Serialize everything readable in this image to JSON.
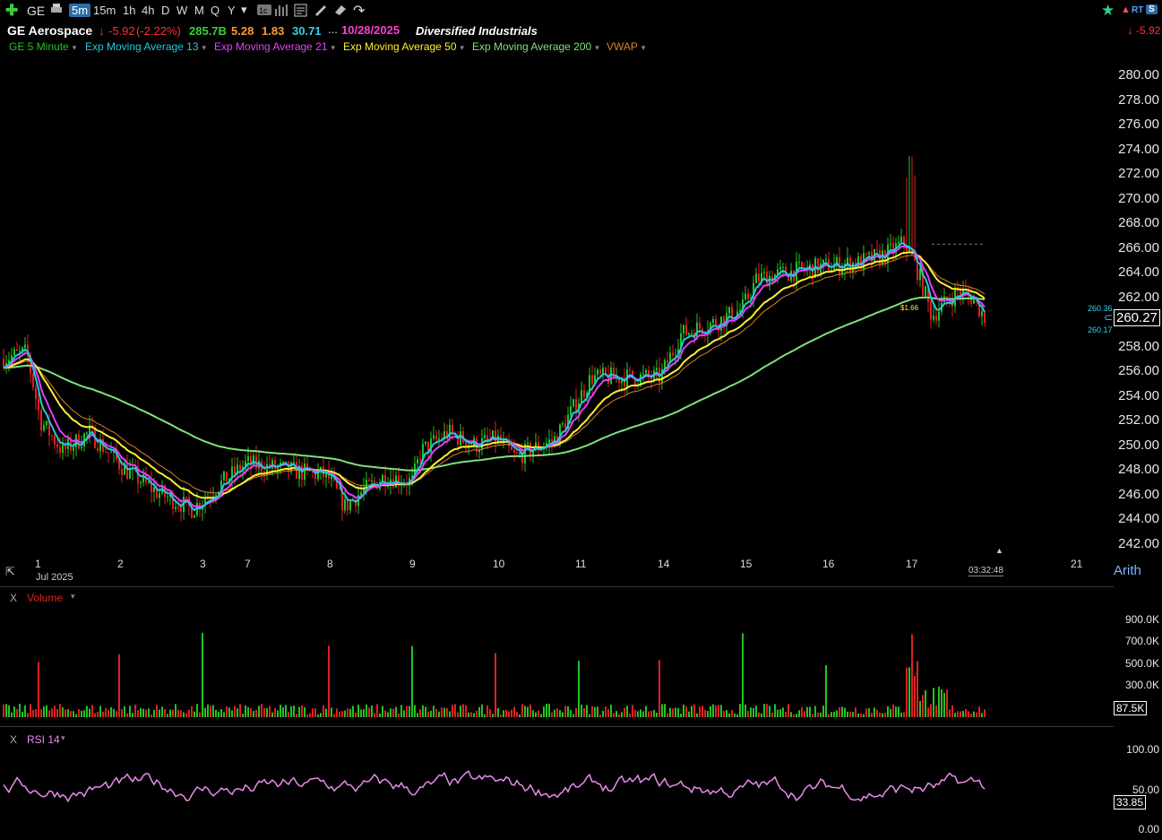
{
  "toolbar": {
    "symbol": "GE",
    "timeframes": [
      "5m",
      "15m",
      "1h",
      "4h",
      "D",
      "W",
      "M",
      "Q",
      "Y"
    ],
    "selected": "5m",
    "rt_badge": "RT",
    "s_badge": "S"
  },
  "info": {
    "name": "GE Aerospace",
    "change": "-5.92",
    "change_pct": "(-2.22%)",
    "market_cap": "285.7B",
    "v1": "5.28",
    "v2": "1.83",
    "v3": "30.71",
    "ellipsis": "...",
    "date": "10/28/2025",
    "sector": "Diversified Industrials",
    "right_change": "-5.92"
  },
  "studies": [
    {
      "label": "GE 5 Minute",
      "color": "#22c322"
    },
    {
      "label": "Exp Moving Average 13",
      "color": "#26c6da"
    },
    {
      "label": "Exp Moving Average 21",
      "color": "#e040fb"
    },
    {
      "label": "Exp Moving Average 50",
      "color": "#ffee33"
    },
    {
      "label": "Exp Moving Average 200",
      "color": "#7ee07e"
    },
    {
      "label": "VWAP",
      "color": "#d9822b"
    }
  ],
  "price_axis": {
    "ticks": [
      "280.00",
      "278.00",
      "276.00",
      "274.00",
      "272.00",
      "270.00",
      "268.00",
      "266.00",
      "264.00",
      "262.00",
      "260.00",
      "258.00",
      "256.00",
      "254.00",
      "252.00",
      "250.00",
      "248.00",
      "246.00",
      "244.00",
      "242.00"
    ],
    "last_price": "260.27",
    "bid": "260.36",
    "ask": "260.17",
    "marker": "$1.66",
    "scale": "Arith"
  },
  "time_axis": {
    "labels": [
      "1",
      "2",
      "3",
      "7",
      "8",
      "9",
      "10",
      "11",
      "14",
      "15",
      "16",
      "17",
      "21"
    ],
    "month": "Jul 2025",
    "clock": "03:32:48"
  },
  "volume": {
    "title": "Volume",
    "close_x": "X",
    "ticks": [
      "900.0K",
      "700.0K",
      "500.0K",
      "300.0K"
    ],
    "last": "87.5K"
  },
  "rsi": {
    "title": "RSI 14",
    "close_x": "X",
    "ticks": [
      "100.00",
      "50.00",
      "0.00"
    ],
    "last": "33.85"
  },
  "colors": {
    "up": "#22c322",
    "down": "#e02020",
    "ema13": "#26c6da",
    "ema21": "#e040fb",
    "ema50": "#ffee33",
    "ema200": "#7ee07e",
    "vwap": "#d9822b",
    "rsi": "#e98be9"
  },
  "chart_data": {
    "type": "line",
    "title": "GE Aerospace",
    "x": [
      "1",
      "2",
      "3",
      "7",
      "8",
      "9",
      "10",
      "11",
      "14",
      "15",
      "16",
      "17"
    ],
    "series": [
      {
        "name": "GE 5 Minute",
        "values": [
          257.0,
          250.5,
          244.8,
          248.5,
          245.0,
          247.5,
          250.5,
          255.5,
          255.5,
          263.5,
          264.0,
          261.8
        ]
      },
      {
        "name": "Exp Moving Average 200",
        "values": [
          254.5,
          252.0,
          249.0,
          248.3,
          247.8,
          247.5,
          248.5,
          250.5,
          254.0,
          259.0,
          261.5,
          262.8
        ]
      }
    ],
    "ylim": [
      242,
      281
    ]
  }
}
